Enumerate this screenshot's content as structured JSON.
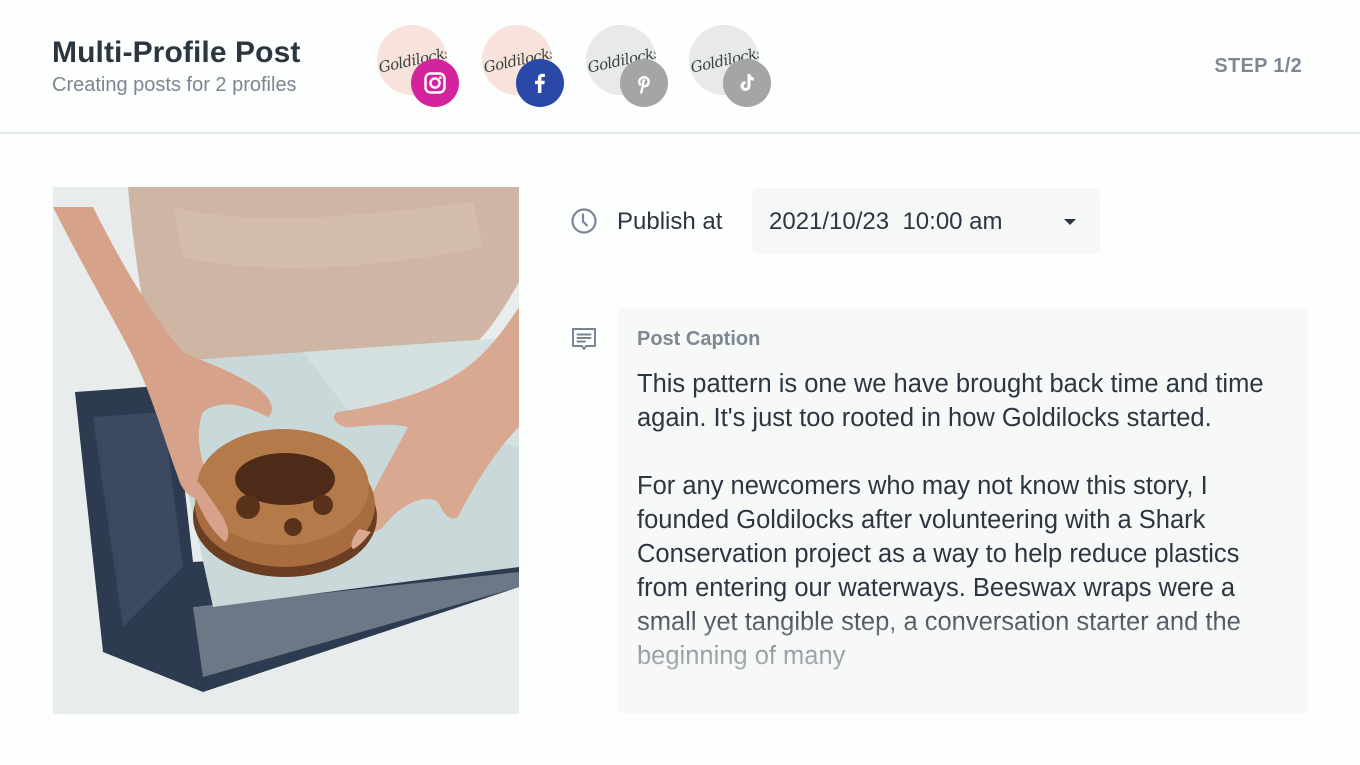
{
  "header": {
    "title": "Multi-Profile Post",
    "subtitle": "Creating posts for 2 profiles",
    "step": "STEP 1/2"
  },
  "profiles": [
    {
      "name": "Goldilocks",
      "network": "instagram",
      "icon": "instagram-icon",
      "selected": true,
      "badge_color": "#d3239c",
      "avatar_bg": "#f7e3dc"
    },
    {
      "name": "Goldilocks",
      "network": "facebook",
      "icon": "facebook-icon",
      "selected": true,
      "badge_color": "#2a48a8",
      "avatar_bg": "#f7e3dc"
    },
    {
      "name": "Goldilocks",
      "network": "pinterest",
      "icon": "pinterest-icon",
      "selected": false,
      "badge_color": "#a3a5a6",
      "avatar_bg": "#e8e9ea"
    },
    {
      "name": "Goldilocks",
      "network": "tiktok",
      "icon": "tiktok-icon",
      "selected": false,
      "badge_color": "#a3a5a6",
      "avatar_bg": "#e8e9ea"
    }
  ],
  "media": {
    "description": "Hands holding a stack of chocolate chip cookies on a beeswax wrap"
  },
  "publish": {
    "label": "Publish at",
    "value": "2021/10/23  10:00 am",
    "icon": "clock-icon"
  },
  "caption": {
    "label": "Post Caption",
    "icon": "comment-icon",
    "paragraphs": [
      "This pattern is one we have brought back time and time again. It's just too rooted in how Goldilocks started.",
      "For any newcomers who may not know this story, I founded Goldilocks after volunteering with a Shark Conservation project as a way to help reduce plastics from entering our waterways. Beeswax wraps were a small yet tangible step, a conversation starter and the beginning of many"
    ]
  },
  "colors": {
    "text_primary": "#2b3640",
    "text_muted": "#7d8893",
    "instagram": "#d3239c",
    "facebook": "#2a48a8",
    "inactive": "#a3a5a6"
  }
}
